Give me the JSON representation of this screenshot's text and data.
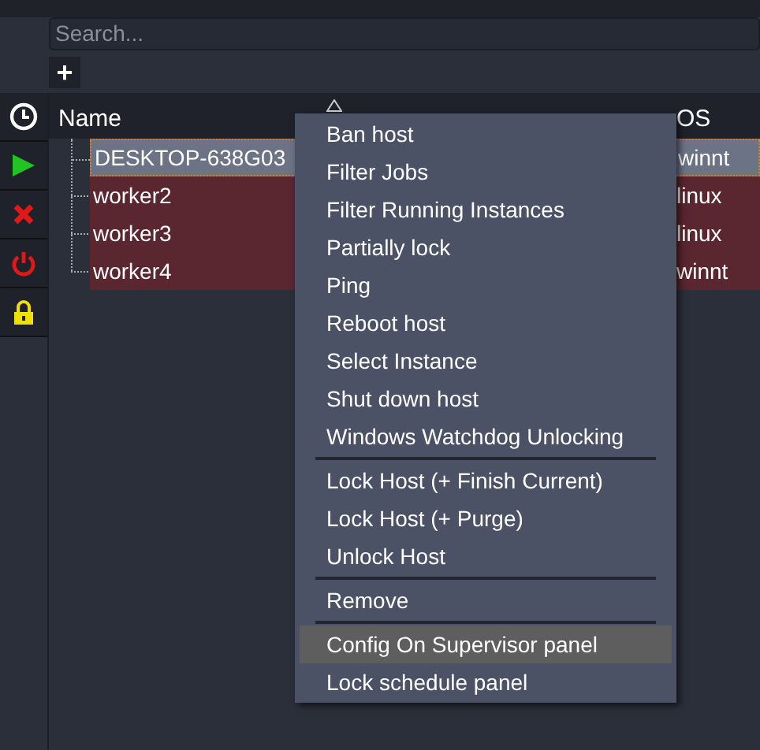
{
  "search": {
    "placeholder": "Search..."
  },
  "add_button": {
    "label": "+"
  },
  "table": {
    "columns": [
      {
        "label": "Name",
        "sorted": true
      },
      {
        "label": "OS",
        "sorted": false
      }
    ],
    "rows": [
      {
        "name": "DESKTOP-638G03",
        "os": "winnt",
        "selected": true
      },
      {
        "name": "worker2",
        "os": "linux",
        "selected": false
      },
      {
        "name": "worker3",
        "os": "linux",
        "selected": false
      },
      {
        "name": "worker4",
        "os": "winnt",
        "selected": false
      }
    ]
  },
  "context_menu": {
    "items": [
      {
        "kind": "item",
        "label": "Ban host",
        "selected": false
      },
      {
        "kind": "item",
        "label": "Filter Jobs",
        "selected": false
      },
      {
        "kind": "item",
        "label": "Filter Running Instances",
        "selected": false
      },
      {
        "kind": "item",
        "label": "Partially lock",
        "selected": false
      },
      {
        "kind": "item",
        "label": "Ping",
        "selected": false
      },
      {
        "kind": "item",
        "label": "Reboot host",
        "selected": false
      },
      {
        "kind": "item",
        "label": "Select Instance",
        "selected": false
      },
      {
        "kind": "item",
        "label": "Shut down host",
        "selected": false
      },
      {
        "kind": "item",
        "label": "Windows Watchdog Unlocking",
        "selected": false
      },
      {
        "kind": "separator"
      },
      {
        "kind": "item",
        "label": "Lock Host (+ Finish Current)",
        "selected": false
      },
      {
        "kind": "item",
        "label": "Lock Host (+ Purge)",
        "selected": false
      },
      {
        "kind": "item",
        "label": "Unlock Host",
        "selected": false
      },
      {
        "kind": "separator"
      },
      {
        "kind": "item",
        "label": "Remove",
        "selected": false
      },
      {
        "kind": "separator"
      },
      {
        "kind": "item",
        "label": "Config On Supervisor panel",
        "selected": true
      },
      {
        "kind": "item",
        "label": "Lock schedule panel",
        "selected": false
      }
    ]
  }
}
